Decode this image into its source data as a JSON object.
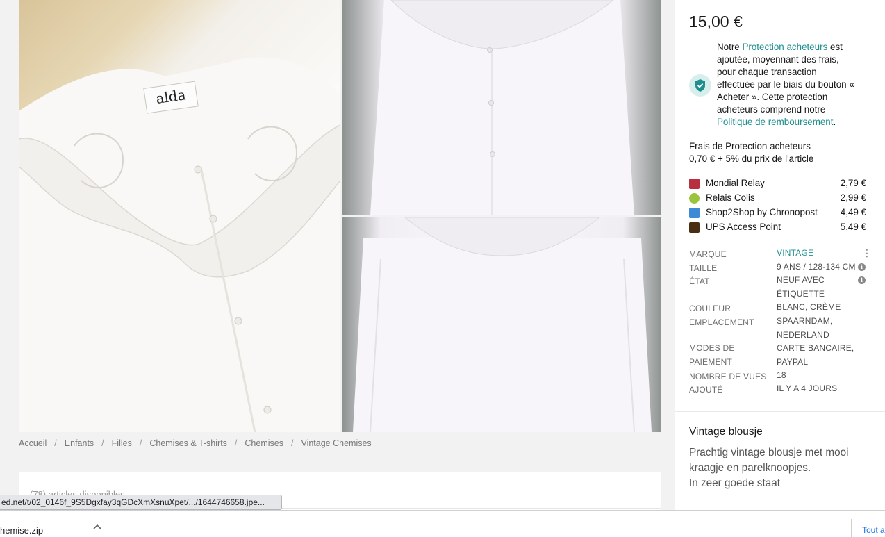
{
  "listing": {
    "price": "15,00 €",
    "protection": {
      "text_1": "Notre ",
      "link_1": "Protection acheteurs",
      "text_2": " est ajoutée, moyennant des frais, pour chaque transaction effectuée par le biais du bouton « Acheter ». Cette protection acheteurs comprend notre ",
      "link_2": "Politique de remboursement",
      "text_3": "."
    },
    "fee_label": "Frais de Protection acheteurs",
    "fee_value": "0,70 € + 5% du prix de l'article",
    "shipping": [
      {
        "name": "Mondial Relay",
        "price": "2,79 €",
        "icon": "mondial-relay-icon",
        "color": "#b8303f"
      },
      {
        "name": "Relais Colis",
        "price": "2,99 €",
        "icon": "relais-colis-icon",
        "color": "#9cc33c"
      },
      {
        "name": "Shop2Shop by Chronopost",
        "price": "4,49 €",
        "icon": "chronopost-icon",
        "color": "#3e8ad6"
      },
      {
        "name": "UPS Access Point",
        "price": "5,49 €",
        "icon": "ups-icon",
        "color": "#4a2e12"
      }
    ],
    "attributes": {
      "brand_label": "MARQUE",
      "brand_value": "VINTAGE",
      "size_label": "TAILLE",
      "size_value": "9 ANS / 128-134 CM",
      "condition_label": "ÉTAT",
      "condition_value": "NEUF AVEC ÉTIQUETTE",
      "color_label": "COULEUR",
      "color_value": "BLANC, CRÈME",
      "location_label": "EMPLACEMENT",
      "location_value": "SPAARNDAM, NEDERLAND",
      "payment_label": "MODES DE PAIEMENT",
      "payment_value": "CARTE BANCAIRE, PAYPAL",
      "views_label": "NOMBRE DE VUES",
      "views_value": "18",
      "added_label": "AJOUTÉ",
      "added_value": "IL Y A 4 JOURS"
    },
    "description_title": "Vintage blousje",
    "description_body": "Prachtig vintage blousje met mooi kraagje en parelknoopjes.\nIn zeer goede staat"
  },
  "breadcrumb": [
    "Accueil",
    "Enfants",
    "Filles",
    "Chemises & T-shirts",
    "Chemises",
    "Vintage Chemises"
  ],
  "items_count": "(78) articles disponibles",
  "status_url": "ed.net/t/02_0146f_9S5Dgxfay3qGDcXmXsnuXpet/.../1644746658.jpe...",
  "download": {
    "file_name": "hemise.zip",
    "show_all": "Tout a"
  },
  "photos": {
    "tag_text": "alda"
  },
  "colors": {
    "accent": "#1e8e8e",
    "shield_bg": "#d8eeed"
  }
}
